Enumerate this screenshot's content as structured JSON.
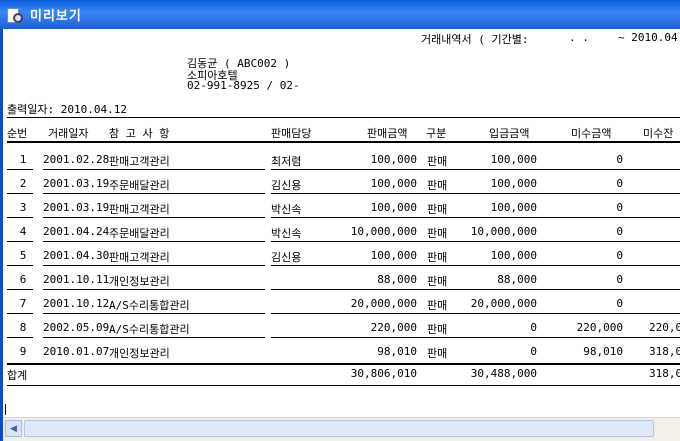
{
  "window": {
    "title": "미리보기"
  },
  "report": {
    "heading": "거래내역서 ( 기간별:",
    "date_from": ". .",
    "date_to": "~ 2010.04.1",
    "customer_name": "김동균 ( ABC002 )",
    "company": "소피아호텔",
    "phone": "02-991-8925 / 02-",
    "print_date_label": "출력일자: 2010.04.12"
  },
  "table": {
    "headers": {
      "no": "순번",
      "date": "거래일자",
      "note": "참 고 사 항",
      "staff": "판매담당",
      "sales": "판매금액",
      "type": "구분",
      "paid": "입금금액",
      "unpaid": "미수금액",
      "balance": "미수잔"
    },
    "rows": [
      {
        "no": "1",
        "date": "2001.02.28",
        "note": "판매고객관리",
        "staff": "최저렴",
        "sales": "100,000",
        "type": "판매",
        "paid": "100,000",
        "unpaid": "0",
        "balance": ""
      },
      {
        "no": "2",
        "date": "2001.03.19",
        "note": "주문배달관리",
        "staff": "김신용",
        "sales": "100,000",
        "type": "판매",
        "paid": "100,000",
        "unpaid": "0",
        "balance": ""
      },
      {
        "no": "3",
        "date": "2001.03.19",
        "note": "판매고객관리",
        "staff": "박신속",
        "sales": "100,000",
        "type": "판매",
        "paid": "100,000",
        "unpaid": "0",
        "balance": ""
      },
      {
        "no": "4",
        "date": "2001.04.24",
        "note": "주문배달관리",
        "staff": "박신속",
        "sales": "10,000,000",
        "type": "판매",
        "paid": "10,000,000",
        "unpaid": "0",
        "balance": ""
      },
      {
        "no": "5",
        "date": "2001.04.30",
        "note": "판매고객관리",
        "staff": "김신용",
        "sales": "100,000",
        "type": "판매",
        "paid": "100,000",
        "unpaid": "0",
        "balance": ""
      },
      {
        "no": "6",
        "date": "2001.10.11",
        "note": "개인정보관리",
        "staff": "",
        "sales": "88,000",
        "type": "판매",
        "paid": "88,000",
        "unpaid": "0",
        "balance": ""
      },
      {
        "no": "7",
        "date": "2001.10.12",
        "note": "A/S수리통합관리",
        "staff": "",
        "sales": "20,000,000",
        "type": "판매",
        "paid": "20,000,000",
        "unpaid": "0",
        "balance": ""
      },
      {
        "no": "8",
        "date": "2002.05.09",
        "note": "A/S수리통합관리",
        "staff": "",
        "sales": "220,000",
        "type": "판매",
        "paid": "0",
        "unpaid": "220,000",
        "balance": "220,0"
      },
      {
        "no": "9",
        "date": "2010.01.07",
        "note": "개인정보관리",
        "staff": "",
        "sales": "98,010",
        "type": "판매",
        "paid": "0",
        "unpaid": "98,010",
        "balance": "318,0"
      }
    ],
    "totals": {
      "label": "합계",
      "sales": "30,806,010",
      "paid": "30,488,000",
      "balance": "318,0"
    }
  },
  "scrollbar": {
    "left_arrow": "◀"
  }
}
